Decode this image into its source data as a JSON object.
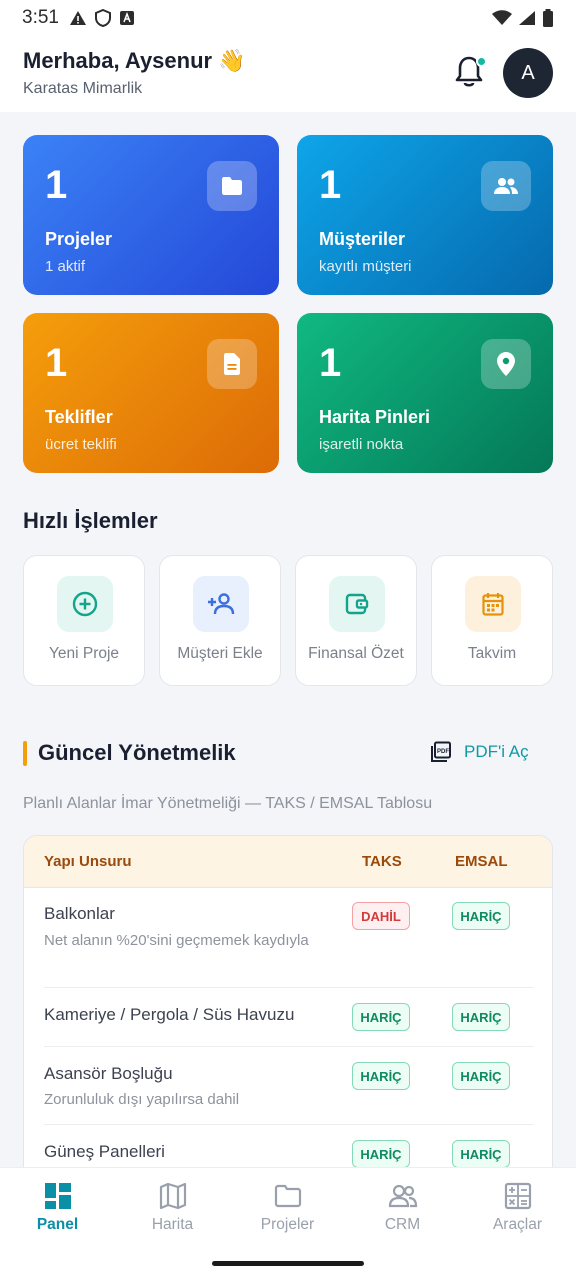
{
  "status": {
    "time": "3:51"
  },
  "header": {
    "greeting": "Merhaba, Aysenur 👋",
    "company": "Karatas Mimarlik",
    "avatar_initial": "A"
  },
  "stats": [
    {
      "value": "1",
      "title": "Projeler",
      "sub": "1 aktif",
      "icon": "folder-icon"
    },
    {
      "value": "1",
      "title": "Müşteriler",
      "sub": "kayıtlı müşteri",
      "icon": "people-icon"
    },
    {
      "value": "1",
      "title": "Teklifler",
      "sub": "ücret teklifi",
      "icon": "document-icon"
    },
    {
      "value": "1",
      "title": "Harita Pinleri",
      "sub": "işaretli nokta",
      "icon": "location-pin-icon"
    }
  ],
  "quick_actions": {
    "title": "Hızlı İşlemler",
    "items": [
      {
        "label": "Yeni Proje",
        "icon": "add-circle-icon",
        "color": "#14a38b"
      },
      {
        "label": "Müşteri Ekle",
        "icon": "add-person-icon",
        "color": "#3b6fe0"
      },
      {
        "label": "Finansal Özet",
        "icon": "wallet-icon",
        "color": "#14a38b"
      },
      {
        "label": "Takvim",
        "icon": "calendar-icon",
        "color": "#e5930b"
      }
    ]
  },
  "regulation": {
    "title": "Güncel Yönetmelik",
    "pdf_label": "PDF'i Aç",
    "description": "Planlı Alanlar İmar Yönetmeliği — TAKS / EMSAL Tablosu",
    "columns": [
      "Yapı Unsuru",
      "TAKS",
      "EMSAL"
    ],
    "rows": [
      {
        "title": "Balkonlar",
        "note": "Net alanın %20'sini geçmemek kaydıyla",
        "taks": "DAHİL",
        "emsal": "HARİÇ"
      },
      {
        "title": "Kameriye / Pergola / Süs Havuzu",
        "note": "",
        "taks": "HARİÇ",
        "emsal": "HARİÇ"
      },
      {
        "title": "Asansör Boşluğu",
        "note": "Zorunluluk dışı yapılırsa dahil",
        "taks": "HARİÇ",
        "emsal": "HARİÇ"
      },
      {
        "title": "Güneş Panelleri",
        "note": "",
        "taks": "HARİÇ",
        "emsal": "HARİÇ"
      }
    ]
  },
  "nav": {
    "active": "Panel",
    "items": [
      {
        "label": "Panel",
        "icon": "dashboard-icon"
      },
      {
        "label": "Harita",
        "icon": "map-icon"
      },
      {
        "label": "Projeler",
        "icon": "folder-icon"
      },
      {
        "label": "CRM",
        "icon": "people-icon"
      },
      {
        "label": "Araçlar",
        "icon": "calculator-icon"
      }
    ]
  },
  "colors": {
    "accent": "#0b8fa6",
    "included": "#d23b3b",
    "excluded": "#0f8a62"
  }
}
